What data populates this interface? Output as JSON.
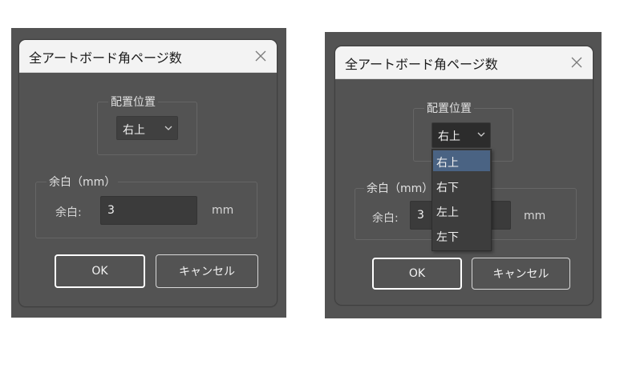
{
  "dialog": {
    "title": "全アートボード角ページ数",
    "placement_group": {
      "legend": "配置位置",
      "selected": "右上"
    },
    "margin_group": {
      "legend": "余白（mm）",
      "field_label": "余白:",
      "field_value": "3",
      "unit": "mm"
    },
    "ok_label": "OK",
    "cancel_label": "キャンセル"
  },
  "dropdown_options": [
    "右上",
    "右下",
    "左上",
    "左下"
  ],
  "colors": {
    "dialog_bg": "#535353",
    "titlebar": "#f3f3f3",
    "selected_option": "#4a6383"
  }
}
